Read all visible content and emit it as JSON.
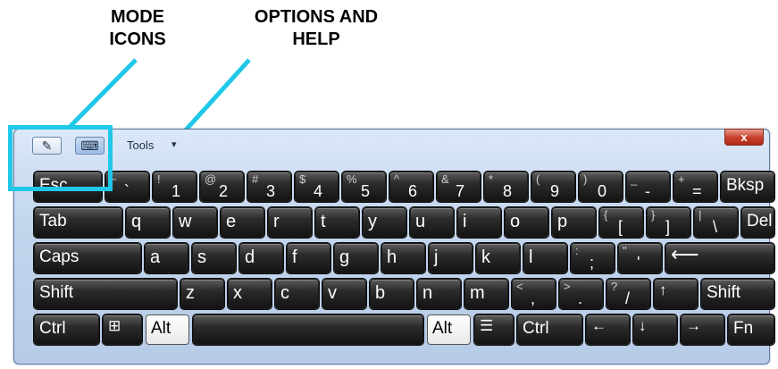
{
  "annotations": {
    "mode_icons": [
      "MODE",
      "ICONS"
    ],
    "options_help": [
      "OPTIONS AND",
      "HELP"
    ]
  },
  "titlebar": {
    "tools_label": "Tools",
    "tools_arrow": "▾",
    "close_label": "x",
    "pen_icon": "✎",
    "keyboard_icon": "⌨"
  },
  "keys": {
    "esc": "Esc",
    "bksp": "Bksp",
    "tab": "Tab",
    "del": "Del",
    "caps": "Caps",
    "enter": "⟵",
    "shift_left": "Shift",
    "shift_right": "Shift",
    "ctrl_left": "Ctrl",
    "win": "⊞",
    "alt_left": "Alt",
    "alt_right": "Alt",
    "menu": "☰",
    "ctrl_right": "Ctrl",
    "left": "←",
    "down": "↓",
    "right": "→",
    "fn": "Fn"
  },
  "number_row": [
    {
      "sh": "~",
      "mn": "`"
    },
    {
      "sh": "!",
      "mn": "1"
    },
    {
      "sh": "@",
      "mn": "2"
    },
    {
      "sh": "#",
      "mn": "3"
    },
    {
      "sh": "$",
      "mn": "4"
    },
    {
      "sh": "%",
      "mn": "5"
    },
    {
      "sh": "^",
      "mn": "6"
    },
    {
      "sh": "&",
      "mn": "7"
    },
    {
      "sh": "*",
      "mn": "8"
    },
    {
      "sh": "(",
      "mn": "9"
    },
    {
      "sh": ")",
      "mn": "0"
    },
    {
      "sh": "_",
      "mn": "-"
    },
    {
      "sh": "+",
      "mn": "="
    }
  ],
  "q_row": [
    "q",
    "w",
    "e",
    "r",
    "t",
    "y",
    "u",
    "i",
    "o",
    "p"
  ],
  "q_row_sym": [
    {
      "sh": "{",
      "mn": "["
    },
    {
      "sh": "}",
      "mn": "]"
    },
    {
      "sh": "|",
      "mn": "\\"
    }
  ],
  "a_row": [
    "a",
    "s",
    "d",
    "f",
    "g",
    "h",
    "j",
    "k",
    "l"
  ],
  "a_row_sym": [
    {
      "sh": ":",
      "mn": ";"
    },
    {
      "sh": "\"",
      "mn": "'"
    }
  ],
  "z_row": [
    "z",
    "x",
    "c",
    "v",
    "b",
    "n",
    "m"
  ],
  "z_row_sym": [
    {
      "sh": "<",
      "mn": ","
    },
    {
      "sh": ">",
      "mn": "."
    },
    {
      "sh": "?",
      "mn": "/"
    }
  ],
  "up_arrow": "↑",
  "colors": {
    "highlight": "#1fc8e8",
    "key_dark": "#1f1f1f",
    "window_bg": "#c3d6ee"
  }
}
